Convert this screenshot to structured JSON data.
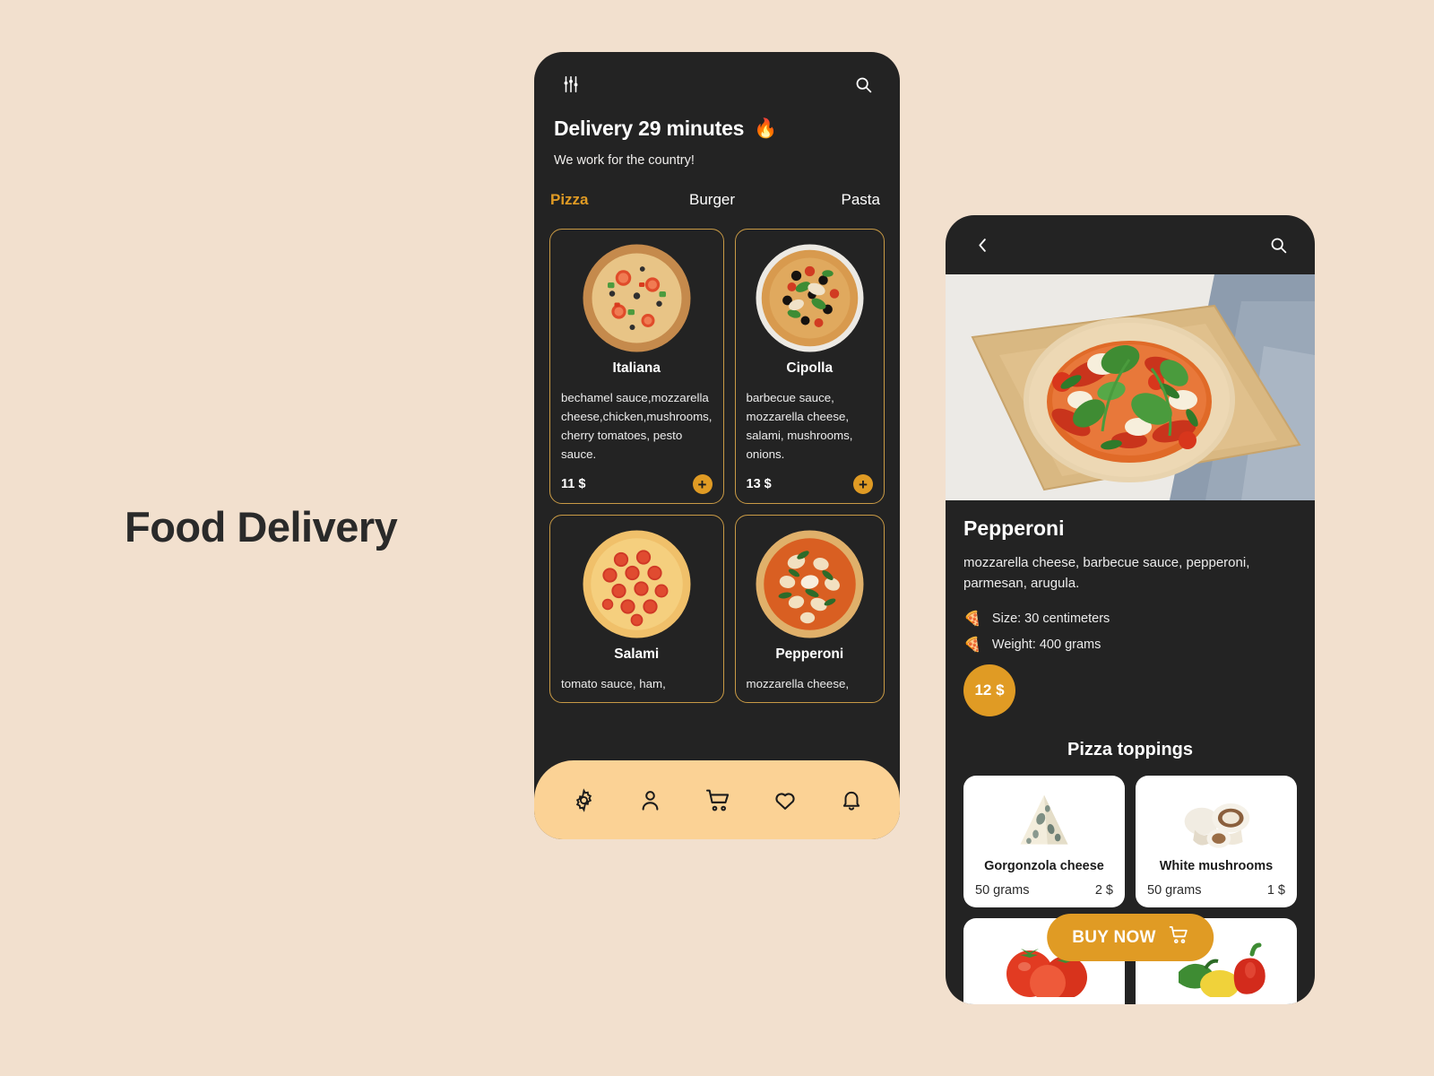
{
  "page": {
    "headline": "Food Delivery",
    "background_color": "#f2e0ce",
    "accent_color": "#e09b24",
    "panel_color": "#232323",
    "nav_bar_color": "#fbd295"
  },
  "list_screen": {
    "topbar": {
      "filter_icon": "sliders-icon",
      "search_icon": "search-icon"
    },
    "title": "Delivery 29 minutes",
    "title_emoji": "🔥",
    "subtitle": "We work for the country!",
    "tabs": [
      {
        "label": "Pizza",
        "active": true
      },
      {
        "label": "Burger",
        "active": false
      },
      {
        "label": "Pasta",
        "active": false
      }
    ],
    "pizzas": [
      {
        "name": "Italiana",
        "description": "bechamel sauce,mozzarella cheese,chicken,mushrooms, cherry tomatoes, pesto sauce.",
        "price": "11 $",
        "add_label": "+"
      },
      {
        "name": "Cipolla",
        "description": "barbecue sauce, mozzarella cheese, salami, mushrooms, onions.",
        "price": "13 $",
        "add_label": "+"
      },
      {
        "name": "Salami",
        "description": "tomato sauce, ham,",
        "price": "",
        "add_label": "+"
      },
      {
        "name": "Pepperoni",
        "description": "mozzarella cheese,",
        "price": "",
        "add_label": "+"
      }
    ],
    "bottom_nav": [
      {
        "icon": "gear-icon",
        "label": "Settings"
      },
      {
        "icon": "person-icon",
        "label": "Profile"
      },
      {
        "icon": "cart-icon",
        "label": "Cart"
      },
      {
        "icon": "heart-icon",
        "label": "Favorites"
      },
      {
        "icon": "bell-icon",
        "label": "Notifications"
      }
    ]
  },
  "detail_screen": {
    "topbar": {
      "back_icon": "chevron-left-icon",
      "search_icon": "search-icon"
    },
    "hero_alt": "Pepperoni pizza on a wooden board",
    "title": "Pepperoni",
    "description": "mozzarella cheese, barbecue sauce, pepperoni, parmesan, arugula.",
    "specs": [
      {
        "icon": "pizza-slice-icon",
        "text": "Size: 30 centimeters"
      },
      {
        "icon": "pizza-slice-icon",
        "text": "Weight: 400 grams"
      }
    ],
    "price": "12 $",
    "toppings_title": "Pizza toppings",
    "toppings": [
      {
        "name": "Gorgonzola cheese",
        "weight": "50 grams",
        "price": "2 $",
        "image": "cheese-wedge"
      },
      {
        "name": "White mushrooms",
        "weight": "50 grams",
        "price": "1 $",
        "image": "mushrooms"
      },
      {
        "name": "",
        "weight": "",
        "price": "",
        "image": "tomatoes"
      },
      {
        "name": "",
        "weight": "",
        "price": "",
        "image": "peppers"
      }
    ],
    "buy_button": {
      "label": "BUY NOW",
      "icon": "cart-icon"
    }
  }
}
